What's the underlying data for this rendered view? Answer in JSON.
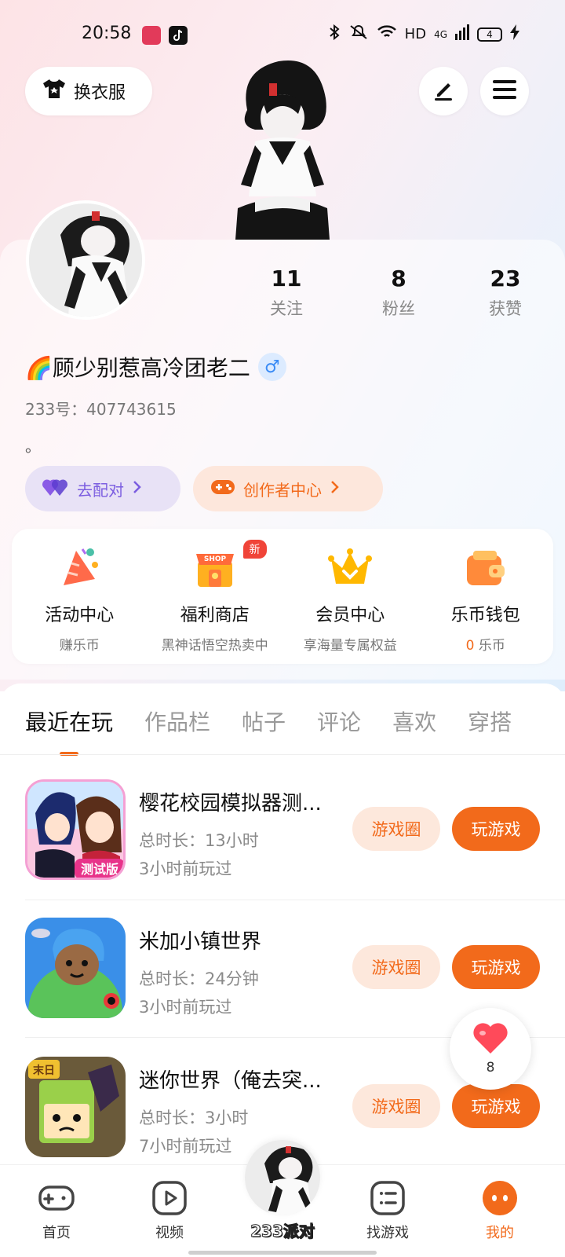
{
  "status_bar": {
    "time": "20:58",
    "network": "HD",
    "signal_type": "4G",
    "battery": "4"
  },
  "header": {
    "dress_label": "换衣服",
    "edit_icon": "pen-icon",
    "menu_icon": "hamburger-menu-icon"
  },
  "profile": {
    "stats": [
      {
        "value": "11",
        "label": "关注"
      },
      {
        "value": "8",
        "label": "粉丝"
      },
      {
        "value": "23",
        "label": "获赞"
      }
    ],
    "nickname": "🌈顾少别惹高冷团老二",
    "gender": "♂",
    "uid": "233号：407743615",
    "bio": "。",
    "match_label": "去配对",
    "creator_label": "创作者中心"
  },
  "services": [
    {
      "title": "活动中心",
      "sub": "赚乐币",
      "icon": "party-hat-icon"
    },
    {
      "title": "福利商店",
      "sub": "黑神话悟空热卖中",
      "icon": "shop-icon",
      "badge": "新"
    },
    {
      "title": "会员中心",
      "sub": "享海量专属权益",
      "icon": "crown-icon"
    },
    {
      "title": "乐币钱包",
      "sub_value": "0",
      "sub_unit": " 乐币",
      "icon": "wallet-icon"
    }
  ],
  "tabs": [
    "最近在玩",
    "作品栏",
    "帖子",
    "评论",
    "喜欢",
    "穿搭"
  ],
  "games": [
    {
      "name": "樱花校园模拟器测...",
      "duration": "总时长：13小时",
      "last_played": "3小时前玩过",
      "circle_label": "游戏圈",
      "play_label": "玩游戏"
    },
    {
      "name": "米加小镇世界",
      "duration": "总时长：24分钟",
      "last_played": "3小时前玩过",
      "circle_label": "游戏圈",
      "play_label": "玩游戏"
    },
    {
      "name": "迷你世界（俺去突...",
      "duration": "总时长：3小时",
      "last_played": "7小时前玩过",
      "circle_label": "游戏圈",
      "play_label": "玩游戏"
    }
  ],
  "float_like": {
    "count": "8"
  },
  "bottom_nav": {
    "items": [
      "首页",
      "视频",
      "找游戏",
      "我的"
    ],
    "center_label": "233派对"
  },
  "colors": {
    "accent": "#f26a1b",
    "purple": "#7b5de0"
  }
}
